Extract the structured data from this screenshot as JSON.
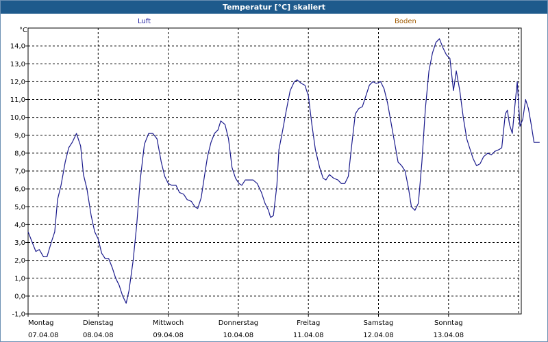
{
  "window": {
    "title": "Temperatur [°C] skaliert"
  },
  "legend": {
    "luft": "Luft",
    "boden": "Boden",
    "luft_color": "#1a1a8c",
    "boden_color": "#a05a00"
  },
  "chart_data": {
    "type": "line",
    "title": "Temperatur [°C] skaliert",
    "ylabel": "°C",
    "ylim": [
      -1.0,
      15.0
    ],
    "yticks": [
      -1.0,
      0.0,
      1.0,
      2.0,
      3.0,
      4.0,
      5.0,
      6.0,
      7.0,
      8.0,
      9.0,
      10.0,
      11.0,
      12.0,
      13.0,
      14.0
    ],
    "ytick_labels": [
      "-1,0",
      "0,0",
      "1,0",
      "2,0",
      "3,0",
      "4,0",
      "5,0",
      "6,0",
      "7,0",
      "8,0",
      "9,0",
      "10,0",
      "11,0",
      "12,0",
      "13,0",
      "14,0"
    ],
    "xlim": [
      0,
      7.05
    ],
    "x_unit": "days from Montag 07.04.08",
    "day_labels": [
      {
        "day": "Montag",
        "date": "07.04.08",
        "x": 0
      },
      {
        "day": "Dienstag",
        "date": "08.04.08",
        "x": 1
      },
      {
        "day": "Mittwoch",
        "date": "09.04.08",
        "x": 2
      },
      {
        "day": "Donnerstag",
        "date": "10.04.08",
        "x": 3
      },
      {
        "day": "Freitag",
        "date": "11.04.08",
        "x": 4
      },
      {
        "day": "Samstag",
        "date": "12.04.08",
        "x": 5
      },
      {
        "day": "Sonntag",
        "date": "13.04.08",
        "x": 6
      }
    ],
    "grid": true,
    "series": [
      {
        "name": "Luft",
        "color": "#1a1a8c",
        "points": [
          [
            0.0,
            3.6
          ],
          [
            0.06,
            3.0
          ],
          [
            0.11,
            2.5
          ],
          [
            0.16,
            2.6
          ],
          [
            0.22,
            2.2
          ],
          [
            0.27,
            2.2
          ],
          [
            0.33,
            3.0
          ],
          [
            0.38,
            3.6
          ],
          [
            0.42,
            5.4
          ],
          [
            0.47,
            6.2
          ],
          [
            0.53,
            7.5
          ],
          [
            0.58,
            8.3
          ],
          [
            0.63,
            8.6
          ],
          [
            0.69,
            9.1
          ],
          [
            0.75,
            8.4
          ],
          [
            0.79,
            6.8
          ],
          [
            0.84,
            6.0
          ],
          [
            0.9,
            4.5
          ],
          [
            0.95,
            3.6
          ],
          [
            1.0,
            3.2
          ],
          [
            1.05,
            2.4
          ],
          [
            1.1,
            2.1
          ],
          [
            1.15,
            2.1
          ],
          [
            1.2,
            1.6
          ],
          [
            1.25,
            1.0
          ],
          [
            1.3,
            0.6
          ],
          [
            1.35,
            0.0
          ],
          [
            1.4,
            -0.4
          ],
          [
            1.44,
            0.3
          ],
          [
            1.5,
            2.0
          ],
          [
            1.55,
            4.0
          ],
          [
            1.6,
            6.5
          ],
          [
            1.66,
            8.5
          ],
          [
            1.72,
            9.1
          ],
          [
            1.78,
            9.1
          ],
          [
            1.84,
            8.8
          ],
          [
            1.9,
            7.5
          ],
          [
            1.95,
            6.7
          ],
          [
            2.0,
            6.3
          ],
          [
            2.05,
            6.2
          ],
          [
            2.11,
            6.2
          ],
          [
            2.16,
            5.8
          ],
          [
            2.22,
            5.7
          ],
          [
            2.27,
            5.4
          ],
          [
            2.33,
            5.3
          ],
          [
            2.38,
            5.0
          ],
          [
            2.42,
            4.9
          ],
          [
            2.47,
            5.5
          ],
          [
            2.52,
            6.8
          ],
          [
            2.56,
            7.8
          ],
          [
            2.61,
            8.6
          ],
          [
            2.66,
            9.1
          ],
          [
            2.71,
            9.3
          ],
          [
            2.75,
            9.8
          ],
          [
            2.81,
            9.6
          ],
          [
            2.86,
            8.8
          ],
          [
            2.91,
            7.2
          ],
          [
            2.96,
            6.6
          ],
          [
            3.01,
            6.3
          ],
          [
            3.05,
            6.2
          ],
          [
            3.1,
            6.5
          ],
          [
            3.16,
            6.5
          ],
          [
            3.21,
            6.5
          ],
          [
            3.27,
            6.3
          ],
          [
            3.33,
            5.8
          ],
          [
            3.38,
            5.2
          ],
          [
            3.43,
            4.8
          ],
          [
            3.46,
            4.4
          ],
          [
            3.5,
            4.5
          ],
          [
            3.55,
            6.2
          ],
          [
            3.58,
            8.2
          ],
          [
            3.63,
            9.2
          ],
          [
            3.68,
            10.3
          ],
          [
            3.74,
            11.5
          ],
          [
            3.8,
            12.0
          ],
          [
            3.84,
            12.1
          ],
          [
            3.9,
            11.9
          ],
          [
            3.95,
            11.8
          ],
          [
            4.0,
            11.2
          ],
          [
            4.05,
            9.6
          ],
          [
            4.1,
            8.2
          ],
          [
            4.16,
            7.2
          ],
          [
            4.21,
            6.6
          ],
          [
            4.25,
            6.5
          ],
          [
            4.3,
            6.8
          ],
          [
            4.36,
            6.6
          ],
          [
            4.42,
            6.5
          ],
          [
            4.47,
            6.3
          ],
          [
            4.52,
            6.3
          ],
          [
            4.57,
            6.7
          ],
          [
            4.62,
            8.5
          ],
          [
            4.67,
            10.2
          ],
          [
            4.72,
            10.5
          ],
          [
            4.77,
            10.6
          ],
          [
            4.82,
            11.2
          ],
          [
            4.87,
            11.8
          ],
          [
            4.92,
            12.0
          ],
          [
            4.97,
            11.9
          ],
          [
            5.03,
            12.0
          ],
          [
            5.08,
            11.6
          ],
          [
            5.13,
            10.8
          ],
          [
            5.18,
            9.7
          ],
          [
            5.23,
            8.6
          ],
          [
            5.28,
            7.5
          ],
          [
            5.33,
            7.3
          ],
          [
            5.38,
            7.0
          ],
          [
            5.43,
            6.0
          ],
          [
            5.47,
            5.0
          ],
          [
            5.52,
            4.8
          ],
          [
            5.57,
            5.2
          ],
          [
            5.62,
            7.5
          ],
          [
            5.67,
            10.5
          ],
          [
            5.72,
            12.6
          ],
          [
            5.77,
            13.6
          ],
          [
            5.82,
            14.2
          ],
          [
            5.87,
            14.4
          ],
          [
            5.92,
            13.9
          ],
          [
            5.97,
            13.5
          ],
          [
            6.02,
            13.3
          ],
          [
            6.07,
            11.5
          ],
          [
            6.11,
            12.6
          ],
          [
            6.16,
            11.5
          ],
          [
            6.21,
            10.0
          ],
          [
            6.26,
            8.8
          ],
          [
            6.3,
            8.3
          ],
          [
            6.35,
            7.7
          ],
          [
            6.4,
            7.3
          ],
          [
            6.45,
            7.4
          ],
          [
            6.5,
            7.8
          ],
          [
            6.56,
            8.0
          ],
          [
            6.61,
            7.9
          ],
          [
            6.66,
            8.1
          ],
          [
            6.72,
            8.2
          ],
          [
            6.76,
            8.3
          ],
          [
            6.81,
            10.2
          ],
          [
            6.84,
            10.4
          ],
          [
            6.87,
            9.6
          ],
          [
            6.91,
            9.1
          ],
          [
            6.94,
            10.4
          ],
          [
            6.98,
            12.0
          ],
          [
            7.02,
            9.5
          ],
          [
            7.06,
            9.9
          ],
          [
            7.1,
            11.0
          ],
          [
            7.14,
            10.5
          ],
          [
            7.18,
            9.6
          ],
          [
            7.22,
            8.6
          ],
          [
            7.26,
            8.6
          ],
          [
            7.3,
            8.6
          ]
        ]
      }
    ]
  }
}
